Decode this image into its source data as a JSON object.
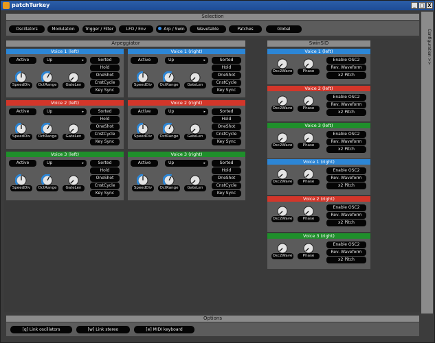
{
  "window": {
    "title": "patchTurkey",
    "min": "_",
    "max": "□",
    "close": "X"
  },
  "selection": {
    "header": "Selection",
    "tabs": [
      "Oscillators",
      "Modulation",
      "Trigger / Filter",
      "LFO / Env",
      "Arp / Swin",
      "Wavetable",
      "Patches",
      "Global"
    ],
    "active_tab": "Arp / Swin"
  },
  "configuration": {
    "label": "Configuration >>"
  },
  "arpeggiator": {
    "header": "Arpeggiator",
    "voices": [
      {
        "title": "Voice 1 (left)",
        "color": "#2c86d6",
        "active": "Active",
        "mode": "Up",
        "buttons": [
          "Sorted",
          "Hold",
          "OneShot",
          "CnstCycle",
          "Key Sync"
        ],
        "knobs": [
          "SpeedDiv",
          "OctRange",
          "GateLen"
        ],
        "knob_levels": [
          0.5,
          0.6,
          0.0
        ]
      },
      {
        "title": "Voice 1 (right)",
        "color": "#2c86d6",
        "active": "Active",
        "mode": "Up",
        "buttons": [
          "Sorted",
          "Hold",
          "OneShot",
          "CnstCycle",
          "Key Sync"
        ],
        "knobs": [
          "SpeedDiv",
          "OctRange",
          "GateLen"
        ],
        "knob_levels": [
          0.5,
          0.6,
          0.0
        ]
      },
      {
        "title": "Voice 2 (left)",
        "color": "#d3362a",
        "active": "Active",
        "mode": "Up",
        "buttons": [
          "Sorted",
          "Hold",
          "OneShot",
          "CnstCycle",
          "Key Sync"
        ],
        "knobs": [
          "SpeedDiv",
          "OctRange",
          "GateLen"
        ],
        "knob_levels": [
          0.5,
          0.6,
          0.0
        ]
      },
      {
        "title": "Voice 2 (right)",
        "color": "#d3362a",
        "active": "Active",
        "mode": "Up",
        "buttons": [
          "Sorted",
          "Hold",
          "OneShot",
          "CnstCycle",
          "Key Sync"
        ],
        "knobs": [
          "SpeedDiv",
          "OctRange",
          "GateLen"
        ],
        "knob_levels": [
          0.5,
          0.6,
          0.0
        ]
      },
      {
        "title": "Voice 3 (left)",
        "color": "#1f8f2b",
        "active": "Active",
        "mode": "Up",
        "buttons": [
          "Sorted",
          "Hold",
          "OneShot",
          "CnstCycle",
          "Key Sync"
        ],
        "knobs": [
          "SpeedDiv",
          "OctRange",
          "GateLen"
        ],
        "knob_levels": [
          0.5,
          0.6,
          0.0
        ]
      },
      {
        "title": "Voice 3 (right)",
        "color": "#1f8f2b",
        "active": "Active",
        "mode": "Up",
        "buttons": [
          "Sorted",
          "Hold",
          "OneShot",
          "CnstCycle",
          "Key Sync"
        ],
        "knobs": [
          "SpeedDiv",
          "OctRange",
          "GateLen"
        ],
        "knob_levels": [
          0.5,
          0.6,
          0.0
        ]
      }
    ]
  },
  "swinsid": {
    "header": "SwinSID",
    "voices": [
      {
        "title": "Voice 1 (left)",
        "color": "#2c86d6",
        "knobs": [
          "Osc2Wave",
          "Phase"
        ],
        "knob_levels": [
          0.0,
          0.0
        ],
        "buttons": [
          "Enable OSC2",
          "Rev. Waveform",
          "x2 Pitch"
        ]
      },
      {
        "title": "Voice 2 (left)",
        "color": "#d3362a",
        "knobs": [
          "Osc2Wave",
          "Phase"
        ],
        "knob_levels": [
          0.0,
          0.0
        ],
        "buttons": [
          "Enable OSC2",
          "Rev. Waveform",
          "x2 Pitch"
        ]
      },
      {
        "title": "Voice 3 (left)",
        "color": "#1f8f2b",
        "knobs": [
          "Osc2Wave",
          "Phase"
        ],
        "knob_levels": [
          0.0,
          0.0
        ],
        "buttons": [
          "Enable OSC2",
          "Rev. Waveform",
          "x2 Pitch"
        ]
      },
      {
        "title": "Voice 1 (right)",
        "color": "#2c86d6",
        "knobs": [
          "Osc2Wave",
          "Phase"
        ],
        "knob_levels": [
          0.0,
          0.0
        ],
        "buttons": [
          "Enable OSC2",
          "Rev. Waveform",
          "x2 Pitch"
        ]
      },
      {
        "title": "Voice 2 (right)",
        "color": "#d3362a",
        "knobs": [
          "Osc2Wave",
          "Phase"
        ],
        "knob_levels": [
          0.0,
          0.0
        ],
        "buttons": [
          "Enable OSC2",
          "Rev. Waveform",
          "x2 Pitch"
        ]
      },
      {
        "title": "Voice 3 (right)",
        "color": "#1f8f2b",
        "knobs": [
          "Osc2Wave",
          "Phase"
        ],
        "knob_levels": [
          0.0,
          0.0
        ],
        "buttons": [
          "Enable OSC2",
          "Rev. Waveform",
          "x2 Pitch"
        ]
      }
    ]
  },
  "options": {
    "header": "Options",
    "buttons": [
      "[q] Link oscillators",
      "[w] Link stereo",
      "[e] MIDI keyboard"
    ]
  },
  "colors": {
    "knob_accent": "#2c86d6",
    "knob_body": "#e4e4e4"
  }
}
